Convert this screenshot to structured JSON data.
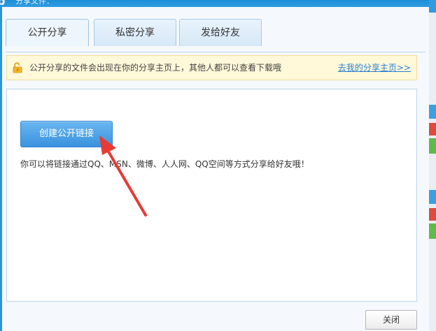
{
  "window": {
    "title": "分享文件：",
    "app_logo": "b"
  },
  "tabs": [
    {
      "label": "公开分享",
      "active": true
    },
    {
      "label": "私密分享",
      "active": false
    },
    {
      "label": "发给好友",
      "active": false
    }
  ],
  "notice": {
    "message": "公开分享的文件会出现在你的分享主页上，其他人都可以查看下载哦",
    "link": "去我的分享主页>>"
  },
  "main": {
    "create_button": "创建公开链接",
    "hint": "你可以将链接通过QQ、MSN、微博、人人网、QQ空间等方式分享给好友哦！"
  },
  "footer": {
    "close_button": "关闭"
  },
  "colors": {
    "accent": "#3a93de",
    "notice_bg": "#fff8d9",
    "link": "#2a7fd0",
    "arrow": "#e83a34"
  }
}
